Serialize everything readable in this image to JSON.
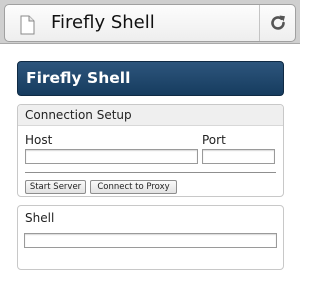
{
  "browser": {
    "page_title": "Firefly Shell",
    "page_icon": "document-icon",
    "reload_icon": "reload-icon"
  },
  "app": {
    "title": "Firefly Shell",
    "header_color": "#1f4a71"
  },
  "connection": {
    "title": "Connection Setup",
    "host_label": "Host",
    "host_value": "",
    "port_label": "Port",
    "port_value": "",
    "start_server_label": "Start Server",
    "connect_proxy_label": "Connect to Proxy"
  },
  "shell": {
    "title": "Shell",
    "input_value": ""
  }
}
